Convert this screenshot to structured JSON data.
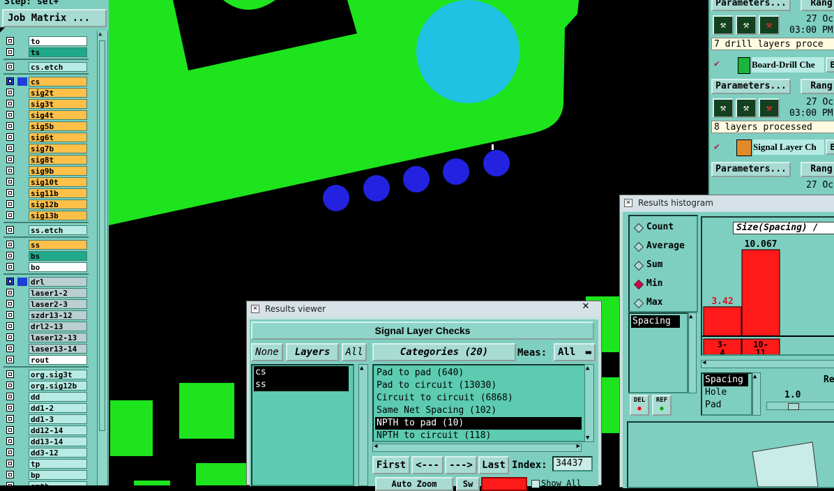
{
  "step_label": "Step: set+",
  "job_matrix_label": "Job Matrix ...",
  "layers": [
    {
      "name": "to",
      "color": "white"
    },
    {
      "name": "ts",
      "color": "teal"
    },
    {
      "name": "cs.etch",
      "color": "lt"
    },
    {
      "name": "cs",
      "color": "or",
      "swatch": "#1b3fd8"
    },
    {
      "name": "sig2t",
      "color": "or"
    },
    {
      "name": "sig3t",
      "color": "or"
    },
    {
      "name": "sig4t",
      "color": "or"
    },
    {
      "name": "sig5b",
      "color": "or"
    },
    {
      "name": "sig6t",
      "color": "or"
    },
    {
      "name": "sig7b",
      "color": "or"
    },
    {
      "name": "sig8t",
      "color": "or"
    },
    {
      "name": "sig9b",
      "color": "or"
    },
    {
      "name": "sig10t",
      "color": "or"
    },
    {
      "name": "sig11b",
      "color": "or"
    },
    {
      "name": "sig12b",
      "color": "or"
    },
    {
      "name": "sig13b",
      "color": "or"
    },
    {
      "name": "ss.etch",
      "color": "lt"
    },
    {
      "name": "ss",
      "color": "or"
    },
    {
      "name": "bs",
      "color": "teal"
    },
    {
      "name": "bo",
      "color": "white"
    },
    {
      "name": "drl",
      "color": "gr",
      "swatch": "#1b3fd8"
    },
    {
      "name": "laser1-2",
      "color": "gr"
    },
    {
      "name": "laser2-3",
      "color": "gr"
    },
    {
      "name": "szdr13-12",
      "color": "gr"
    },
    {
      "name": "drl2-13",
      "color": "gr"
    },
    {
      "name": "laser12-13",
      "color": "gr"
    },
    {
      "name": "laser13-14",
      "color": "gr"
    },
    {
      "name": "rout",
      "color": "white"
    },
    {
      "name": "org.sig3t",
      "color": "lt"
    },
    {
      "name": "org.sig12b",
      "color": "lt"
    },
    {
      "name": "dd",
      "color": "lt"
    },
    {
      "name": "dd1-2",
      "color": "lt"
    },
    {
      "name": "dd1-3",
      "color": "lt"
    },
    {
      "name": "dd12-14",
      "color": "lt"
    },
    {
      "name": "dd13-14",
      "color": "lt"
    },
    {
      "name": "dd3-12",
      "color": "lt"
    },
    {
      "name": "tp",
      "color": "lt"
    },
    {
      "name": "bp",
      "color": "lt"
    },
    {
      "name": "smth",
      "color": "lt"
    }
  ],
  "right_panel": {
    "params_label": "Parameters...",
    "range_label": "Rang",
    "date1": "27 Oc",
    "time1": "03:00 PM",
    "drill_status": "7 drill layers proce",
    "check1": "Board-Drill Che",
    "check1_e": "E",
    "date2": "27 Oc",
    "time2": "03:00 PM",
    "signal_status": "8 layers processed",
    "check2": "Signal Layer Ch",
    "check2_e": "E",
    "date3": "27 Oc"
  },
  "results_viewer": {
    "title": "Results viewer",
    "close": "✕",
    "header": "Signal Layer Checks",
    "none_btn": "None",
    "layers_btn": "Layers",
    "all_btn": "All",
    "categories_btn": "Categories (20)",
    "meas_label": "Meas:",
    "meas_value": "All",
    "layer_items": [
      "cs",
      "ss"
    ],
    "categories": [
      "Pad to pad (640)",
      "Pad to circuit (13030)",
      "Circuit to circuit (6868)",
      "Same Net Spacing (102)",
      "NPTH to pad (10)",
      "NPTH to circuit (118)"
    ],
    "first_btn": "First",
    "prev_btn": "<---",
    "next_btn": "--->",
    "last_btn": "Last",
    "index_label": "Index:",
    "index_value": "34437",
    "autozoom_label": "Auto Zoom",
    "sw_label": "Sw",
    "show_all_label": "Show All"
  },
  "histogram": {
    "title": "Results histogram",
    "modes": [
      "Count",
      "Average",
      "Sum",
      "Min",
      "Max"
    ],
    "selected_mode": "Min",
    "filter_items": [
      "Spacing"
    ],
    "del_label": "DEL",
    "ref_label": "REF",
    "chart_title": "Size(Spacing) /",
    "categories_list": [
      "Spacing",
      "Hole",
      "Pad"
    ],
    "re_label": "Re",
    "scale_value": "1.0"
  },
  "chart_data": {
    "type": "bar",
    "title": "Size(Spacing) /",
    "categories": [
      "3-4",
      "10-11"
    ],
    "category_labels": [
      [
        "3-",
        "4"
      ],
      [
        "10-",
        "11"
      ]
    ],
    "values": [
      3.42,
      10.067
    ],
    "value_labels": [
      "3.42",
      "10.067"
    ],
    "value_label_colors": [
      "#e0102a",
      "#000000"
    ],
    "bar_color": "#ff1a1a",
    "ylim": [
      0,
      10.067
    ],
    "grid": false
  }
}
